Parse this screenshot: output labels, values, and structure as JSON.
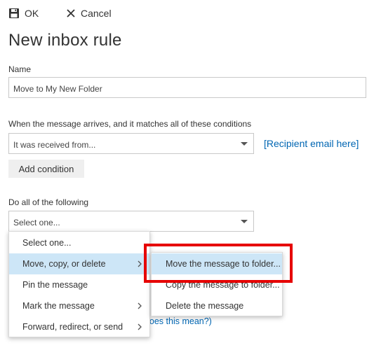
{
  "toolbar": {
    "ok_label": "OK",
    "cancel_label": "Cancel"
  },
  "page_title": "New inbox rule",
  "name_field": {
    "label": "Name",
    "value": "Move to My New Folder"
  },
  "conditions": {
    "label": "When the message arrives, and it matches all of these conditions",
    "select_value": "It was received from...",
    "recipient_link": "[Recipient email here]",
    "add_button": "Add condition"
  },
  "actions": {
    "label": "Do all of the following",
    "select_value": "Select one..."
  },
  "primary_menu": {
    "items": [
      {
        "label": "Select one..."
      },
      {
        "label": "Move, copy, or delete"
      },
      {
        "label": "Pin the message"
      },
      {
        "label": "Mark the message"
      },
      {
        "label": "Forward, redirect, or send"
      }
    ]
  },
  "submenu": {
    "items": [
      {
        "label": "Move the message to folder..."
      },
      {
        "label": "Copy the message to folder..."
      },
      {
        "label": "Delete the message"
      }
    ]
  },
  "help_link_fragment": "t does this mean?)",
  "colors": {
    "accent_link": "#0066b3",
    "hover_bg": "#cde6f7",
    "annotation_red": "#e60000"
  }
}
